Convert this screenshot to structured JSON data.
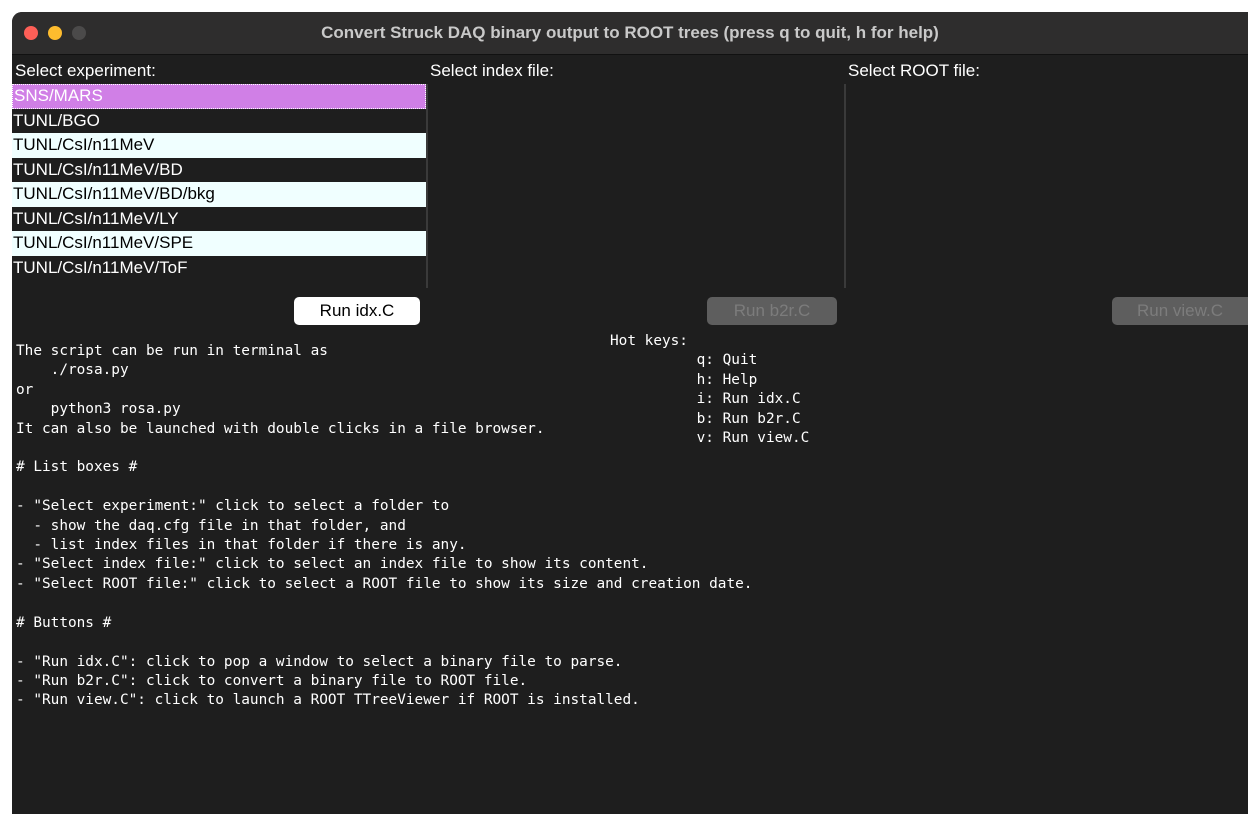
{
  "window": {
    "title": "Convert Struck DAQ binary output to ROOT trees (press q to quit, h for help)"
  },
  "panels": {
    "experiment_label": "Select experiment:",
    "index_label": "Select index file:",
    "root_label": "Select ROOT file:"
  },
  "experiments": [
    "SNS/MARS",
    "TUNL/BGO",
    "TUNL/CsI/n11MeV",
    "TUNL/CsI/n11MeV/BD",
    "TUNL/CsI/n11MeV/BD/bkg",
    "TUNL/CsI/n11MeV/LY",
    "TUNL/CsI/n11MeV/SPE",
    "TUNL/CsI/n11MeV/ToF"
  ],
  "buttons": {
    "run_idx": "Run idx.C",
    "run_b2r": "Run b2r.C",
    "run_view": "Run view.C"
  },
  "output": {
    "hotkeys": "Hot keys:\n          q: Quit\n          h: Help\n          i: Run idx.C\n          b: Run b2r.C\n          v: Run view.C",
    "help_text": "The script can be run in terminal as\n    ./rosa.py\nor\n    python3 rosa.py\nIt can also be launched with double clicks in a file browser.\n\n# List boxes #\n\n- \"Select experiment:\" click to select a folder to\n  - show the daq.cfg file in that folder, and\n  - list index files in that folder if there is any.\n- \"Select index file:\" click to select an index file to show its content.\n- \"Select ROOT file:\" click to select a ROOT file to show its size and creation date.\n\n# Buttons #\n\n- \"Run idx.C\": click to pop a window to select a binary file to parse.\n- \"Run b2r.C\": click to convert a binary file to ROOT file.\n- \"Run view.C\": click to launch a ROOT TTreeViewer if ROOT is installed."
  },
  "colors": {
    "selected": "#d07fe6",
    "row_light": "#f0ffff",
    "background": "#1e1e1e"
  }
}
